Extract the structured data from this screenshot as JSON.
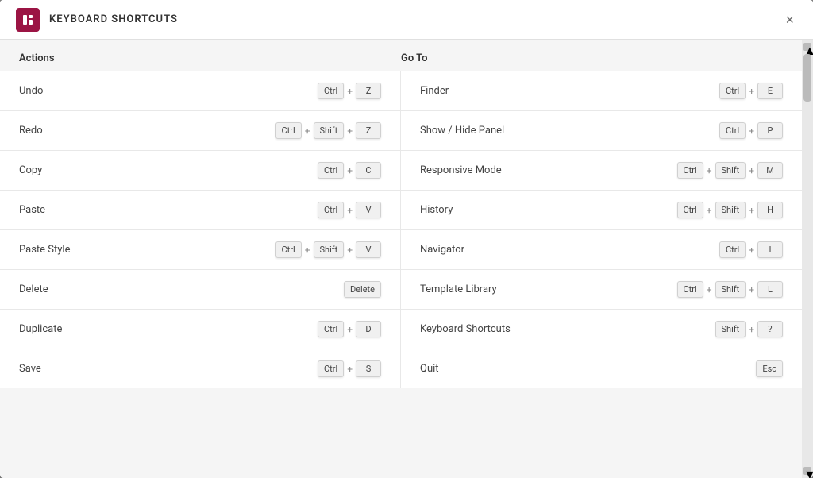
{
  "header": {
    "title": "KEYBOARD SHORTCUTS",
    "logo_letter": "E",
    "close_label": "×"
  },
  "columns": {
    "left": "Actions",
    "right": "Go To"
  },
  "shortcuts": [
    {
      "action": "Undo",
      "action_keys": [
        "Ctrl",
        "+",
        "Z"
      ],
      "goto": "Finder",
      "goto_keys": [
        "Ctrl",
        "+",
        "E"
      ]
    },
    {
      "action": "Redo",
      "action_keys": [
        "Ctrl",
        "+",
        "Shift",
        "+",
        "Z"
      ],
      "goto": "Show / Hide Panel",
      "goto_keys": [
        "Ctrl",
        "+",
        "P"
      ]
    },
    {
      "action": "Copy",
      "action_keys": [
        "Ctrl",
        "+",
        "C"
      ],
      "goto": "Responsive Mode",
      "goto_keys": [
        "Ctrl",
        "+",
        "Shift",
        "+",
        "M"
      ]
    },
    {
      "action": "Paste",
      "action_keys": [
        "Ctrl",
        "+",
        "V"
      ],
      "goto": "History",
      "goto_keys": [
        "Ctrl",
        "+",
        "Shift",
        "+",
        "H"
      ]
    },
    {
      "action": "Paste Style",
      "action_keys": [
        "Ctrl",
        "+",
        "Shift",
        "+",
        "V"
      ],
      "goto": "Navigator",
      "goto_keys": [
        "Ctrl",
        "+",
        "I"
      ]
    },
    {
      "action": "Delete",
      "action_keys": [
        "Delete"
      ],
      "goto": "Template Library",
      "goto_keys": [
        "Ctrl",
        "+",
        "Shift",
        "+",
        "L"
      ]
    },
    {
      "action": "Duplicate",
      "action_keys": [
        "Ctrl",
        "+",
        "D"
      ],
      "goto": "Keyboard Shortcuts",
      "goto_keys": [
        "Shift",
        "+",
        "?"
      ]
    },
    {
      "action": "Save",
      "action_keys": [
        "Ctrl",
        "+",
        "S"
      ],
      "goto": "Quit",
      "goto_keys": [
        "Esc"
      ]
    }
  ]
}
